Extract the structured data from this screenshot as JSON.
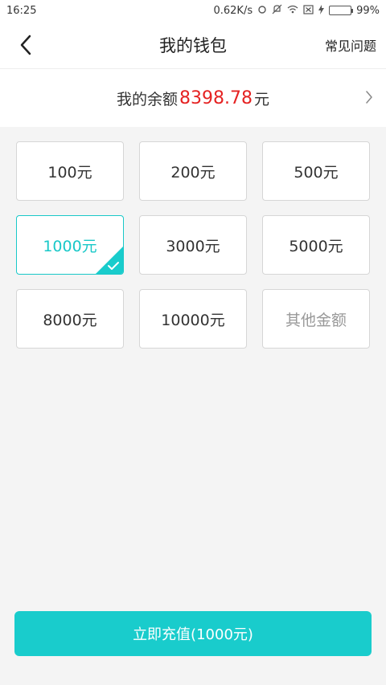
{
  "status_bar": {
    "time": "16:25",
    "network_speed": "0.62K/s",
    "battery_percent": "99%",
    "battery_level": 0.99,
    "icons": [
      "sync-icon",
      "mute-icon",
      "wifi-icon",
      "sim-off-icon",
      "charging-icon",
      "battery-icon"
    ]
  },
  "header": {
    "title": "我的钱包",
    "faq_label": "常见问题"
  },
  "balance": {
    "prefix": "我的余额",
    "amount": "8398.78",
    "suffix": "元"
  },
  "options": [
    {
      "label": "100元",
      "selected": false
    },
    {
      "label": "200元",
      "selected": false
    },
    {
      "label": "500元",
      "selected": false
    },
    {
      "label": "1000元",
      "selected": true
    },
    {
      "label": "3000元",
      "selected": false
    },
    {
      "label": "5000元",
      "selected": false
    },
    {
      "label": "8000元",
      "selected": false
    },
    {
      "label": "10000元",
      "selected": false
    },
    {
      "label": "其他金额",
      "selected": false
    }
  ],
  "cta": {
    "label": "立即充值(1000元)"
  },
  "colors": {
    "accent": "#19cccc",
    "amount_red": "#e52222",
    "background": "#f4f4f4"
  }
}
